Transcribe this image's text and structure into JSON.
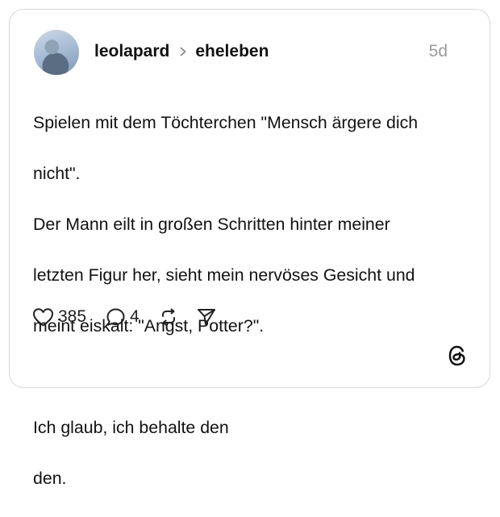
{
  "post": {
    "author": "leolapard",
    "reply_to": "eheleben",
    "time": "5d",
    "lines": [
      "Spielen mit dem Töchterchen \"Mensch ärgere dich",
      "nicht\".",
      "Der Mann eilt in großen Schritten hinter meiner",
      "letzten Figur her, sieht mein nervöses Gesicht und",
      "meint eiskalt: \"Angst, Potter?\".",
      "",
      "Ich glaub, ich behalte den",
      "den."
    ]
  },
  "actions": {
    "likes": "385",
    "replies": "4"
  },
  "icons": {
    "avatar": "user-avatar",
    "separator": "chevron-right-icon",
    "like": "heart-icon",
    "reply": "comment-bubble-icon",
    "repost": "repost-icon",
    "share": "send-icon",
    "brand": "threads-logo-icon"
  },
  "colors": {
    "text": "#111111",
    "muted": "#9a9a9a",
    "border": "#d9d9d9"
  }
}
